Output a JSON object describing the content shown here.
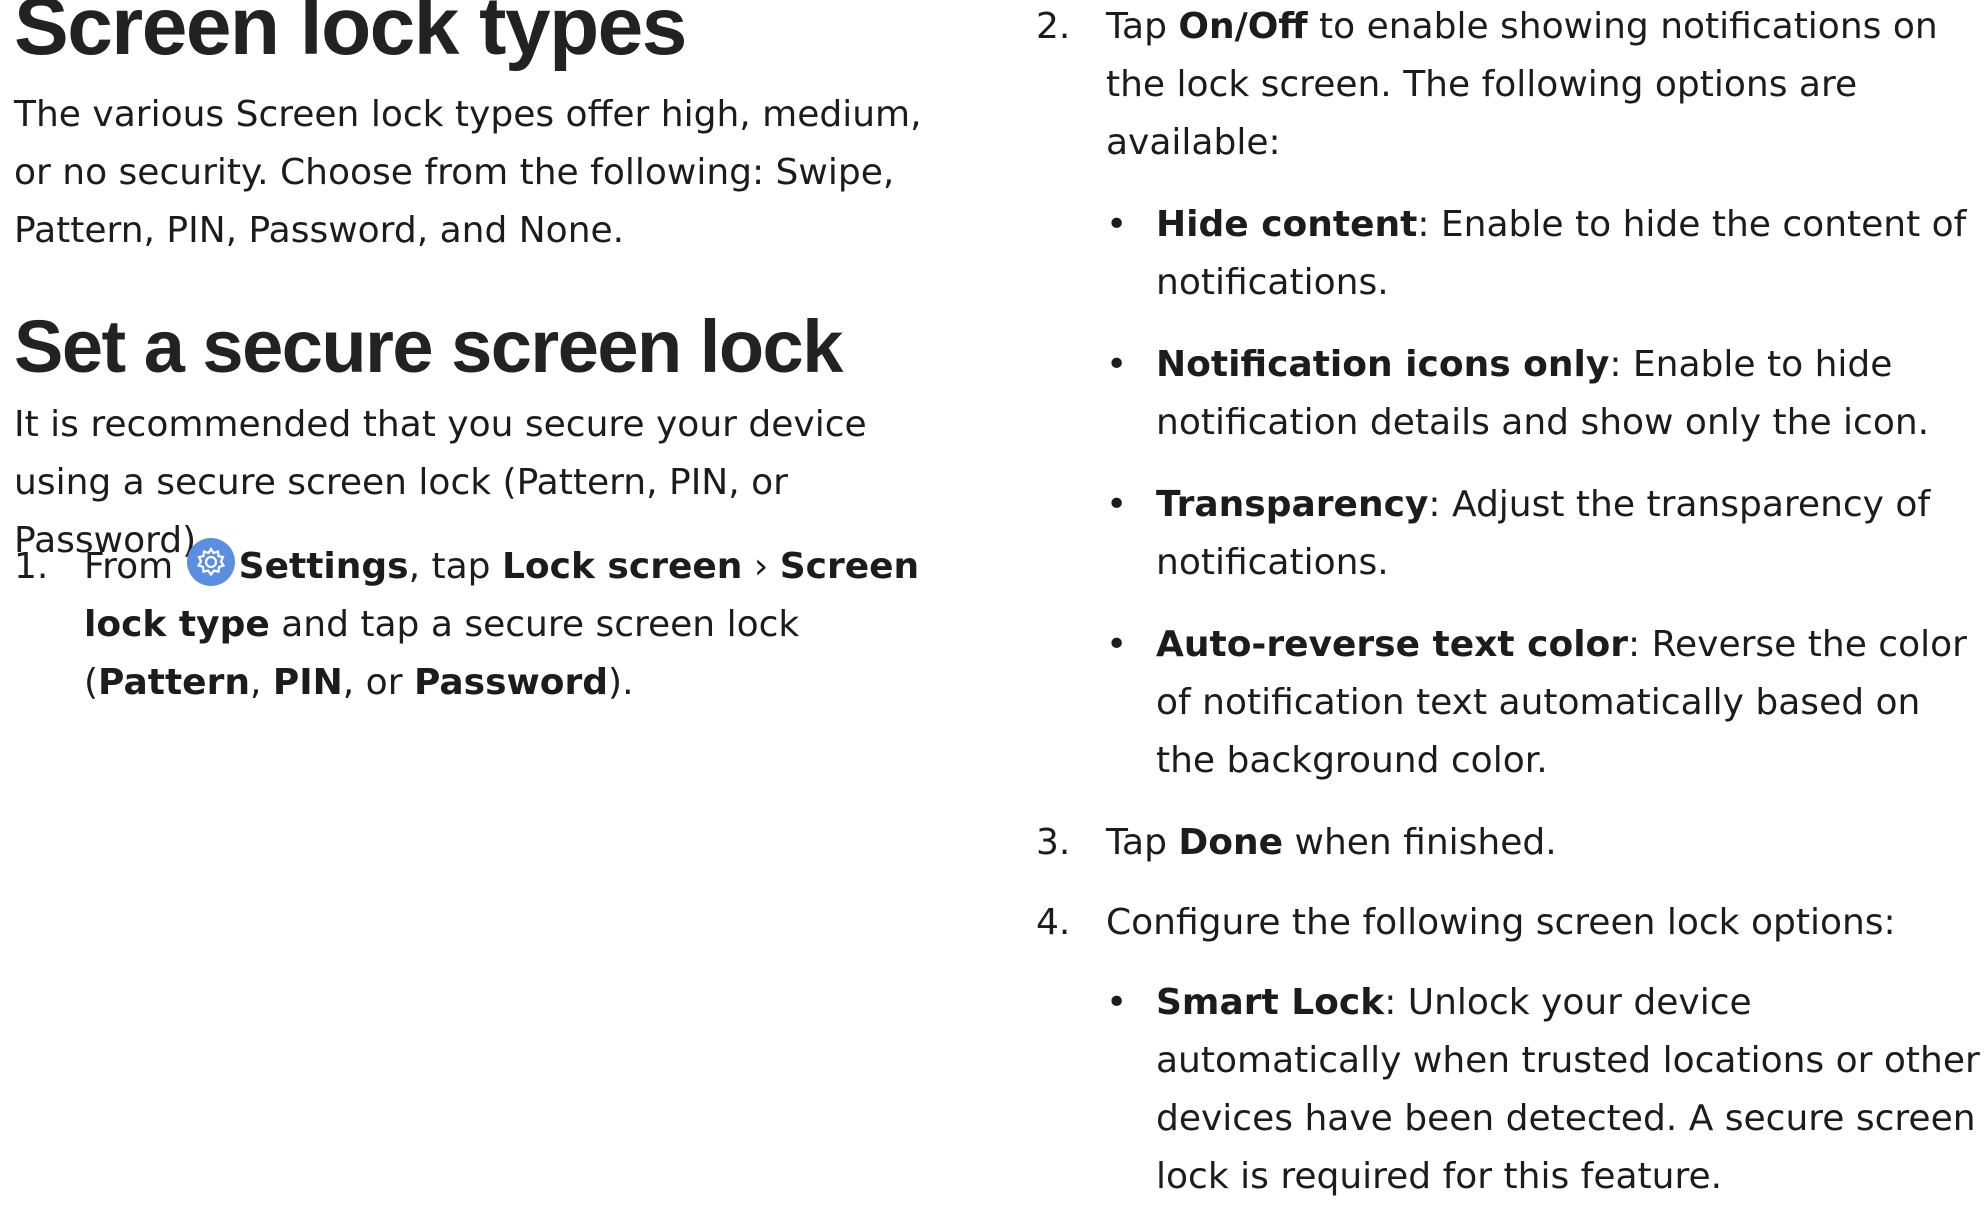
{
  "left": {
    "heading_types": "Screen lock types",
    "para_types": "The various Screen lock types offer high, medium, or no security. Choose from the following: Swipe, Pattern, PIN, Password, and None.",
    "heading_secure": "Set a secure screen lock",
    "para_secure": "It is recommended that you secure your device using a secure screen lock (Pattern, PIN, or Password).",
    "step1": {
      "num": "1.",
      "t1": "From ",
      "icon": "settings-gear-icon",
      "b1": "Settings",
      "t2": ", tap ",
      "b2": "Lock screen",
      "t3": " › ",
      "b3": "Screen lock type",
      "t4": " and tap a secure screen lock (",
      "b4": "Pattern",
      "t5": ", ",
      "b5": "PIN",
      "t6": ", or ",
      "b6": "Password",
      "t7": ")."
    }
  },
  "right": {
    "step2": {
      "num": "2.",
      "t1": "Tap ",
      "b1": "On/Off",
      "t2": " to enable showing notifications on the lock screen. The following options are available:"
    },
    "bullets": [
      {
        "term": "Hide content",
        "text": ": Enable to hide the content of notifications."
      },
      {
        "term": "Notification icons only",
        "text": ": Enable to hide notification details and show only the icon."
      },
      {
        "term": "Transparency",
        "text": ": Adjust the transparency of notifications."
      },
      {
        "term": "Auto-reverse text color",
        "text": ": Reverse the color of notification text automatically based on the background color."
      }
    ],
    "step3": {
      "num": "3.",
      "t1": "Tap ",
      "b1": "Done",
      "t2": " when finished."
    },
    "step4": {
      "num": "4.",
      "t1": "Configure the following screen lock options:"
    },
    "step4_bullets": [
      {
        "term": "Smart Lock",
        "text": ": Unlock your device automatically when trusted locations or other devices have been detected. A secure screen lock is required for this feature."
      }
    ],
    "bullet_glyph": "•"
  },
  "colors": {
    "text": "#1c1c1c",
    "heading": "#222222",
    "icon_bg": "#5b8ee0"
  }
}
